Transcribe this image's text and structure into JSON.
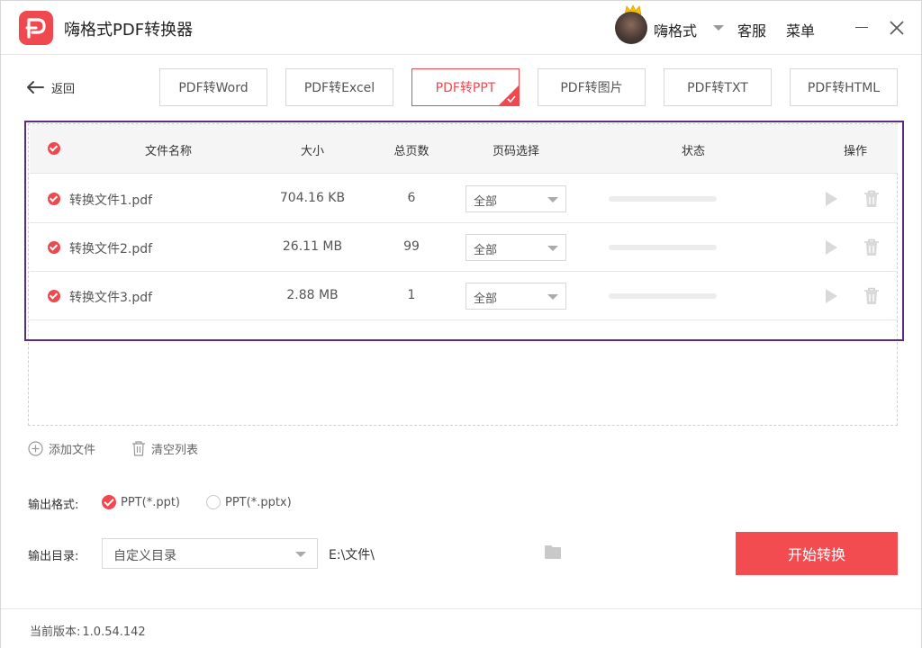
{
  "app": {
    "title": "嗨格式PDF转换器",
    "logo_icon": "pdf-logo-icon",
    "brand_color": "#f0484f"
  },
  "header": {
    "user_name": "嗨格式",
    "service_label": "客服",
    "menu_label": "菜单"
  },
  "nav": {
    "back_label": "返回",
    "tabs": [
      {
        "label": "PDF转Word",
        "active": false
      },
      {
        "label": "PDF转Excel",
        "active": false
      },
      {
        "label": "PDF转PPT",
        "active": true
      },
      {
        "label": "PDF转图片",
        "active": false
      },
      {
        "label": "PDF转TXT",
        "active": false
      },
      {
        "label": "PDF转HTML",
        "active": false
      }
    ]
  },
  "table": {
    "columns": [
      "文件名称",
      "大小",
      "总页数",
      "页码选择",
      "状态",
      "操作"
    ],
    "rows": [
      {
        "name": "转换文件1.pdf",
        "size": "704.16 KB",
        "pages": "6",
        "page_select": "全部",
        "progress": 0,
        "checked": true
      },
      {
        "name": "转换文件2.pdf",
        "size": "26.11 MB",
        "pages": "99",
        "page_select": "全部",
        "progress": 0,
        "checked": true
      },
      {
        "name": "转换文件3.pdf",
        "size": "2.88 MB",
        "pages": "1",
        "page_select": "全部",
        "progress": 0,
        "checked": true
      }
    ]
  },
  "actions": {
    "add_file_label": "添加文件",
    "clear_list_label": "清空列表"
  },
  "output": {
    "format_label": "输出格式:",
    "formats": [
      {
        "label": "PPT(*.ppt)",
        "selected": true
      },
      {
        "label": "PPT(*.pptx)",
        "selected": false
      }
    ],
    "dir_label": "输出目录:",
    "dir_select_value": "自定义目录",
    "dir_path": "E:\\文件\\",
    "start_label": "开始转换"
  },
  "footer": {
    "version_label": "当前版本:",
    "version_value": "1.0.54.142"
  }
}
